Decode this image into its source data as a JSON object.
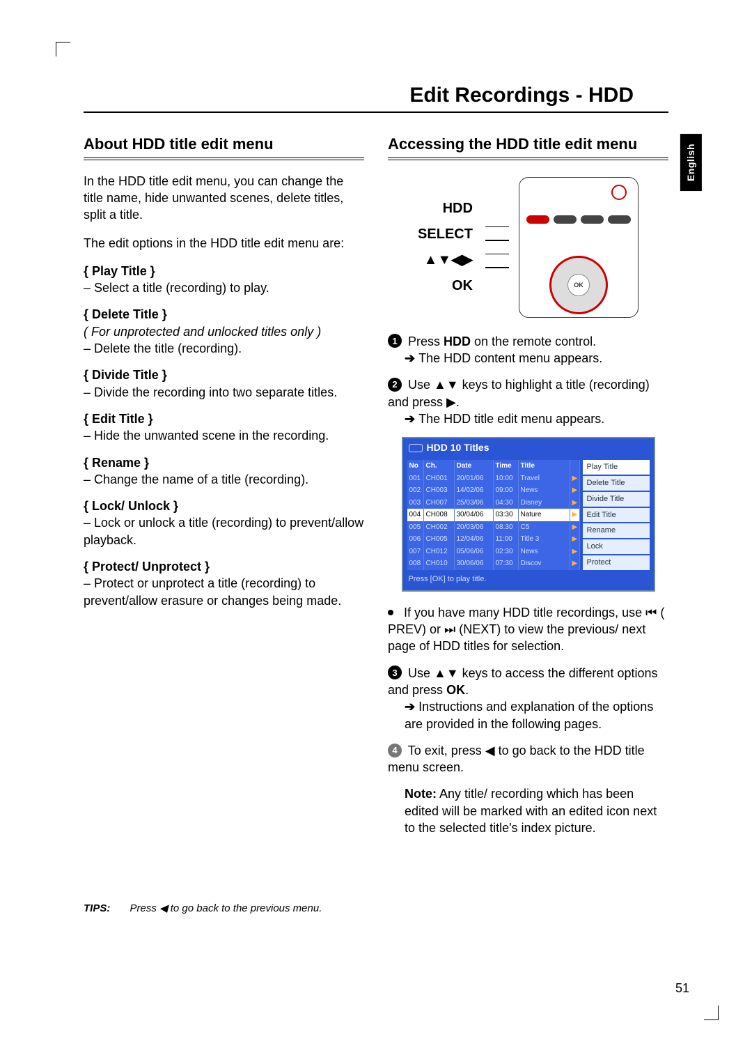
{
  "page_number": "51",
  "language_tab": "English",
  "main_title": "Edit Recordings - HDD",
  "left": {
    "heading": "About HDD title edit menu",
    "intro": "In the HDD title edit menu, you can change the title name, hide unwanted scenes, delete titles, split a title.",
    "intro2": "The edit options in the HDD title edit menu are:",
    "options": [
      {
        "name": "Play Title",
        "note": "",
        "desc": "Select a title (recording) to play."
      },
      {
        "name": "Delete Title",
        "note": "( For unprotected and unlocked titles only )",
        "desc": "Delete the title (recording)."
      },
      {
        "name": "Divide Title",
        "note": "",
        "desc": "Divide the recording into two separate titles."
      },
      {
        "name": "Edit Title",
        "note": "",
        "desc": "Hide the unwanted scene in the recording."
      },
      {
        "name": "Rename",
        "note": "",
        "desc": "Change the name of a title (recording)."
      },
      {
        "name": "Lock/ Unlock",
        "note": "",
        "desc": "Lock or unlock a title (recording) to prevent/allow playback."
      },
      {
        "name": "Protect/ Unprotect",
        "note": "",
        "desc": "Protect or unprotect a title (recording) to prevent/allow erasure or changes being made."
      }
    ]
  },
  "right": {
    "heading": "Accessing the HDD title edit menu",
    "remote_labels": {
      "hdd": "HDD",
      "select": "SELECT",
      "arrows": "▲▼◀▶",
      "ok": "OK"
    },
    "remote_ok": "OK",
    "step1_a": "Press ",
    "step1_bold": "HDD",
    "step1_b": " on the remote control.",
    "step1_result": "The HDD content menu appears.",
    "step2_a": "Use ▲▼ keys to highlight a title (recording) and press ▶.",
    "step2_result": "The HDD title edit menu appears.",
    "bullet_a": "If you have many HDD title recordings, use ⏮ ( PREV) or ⏭ (NEXT) to view the previous/ next page of HDD titles for selection.",
    "step3_a": "Use ▲▼ keys to access the different options and press ",
    "step3_bold": "OK",
    "step3_b": ".",
    "step3_result": "Instructions and explanation of the options are provided in the following pages.",
    "step4": "To exit, press ◀ to go back to the HDD title menu screen.",
    "note_bold": "Note:",
    "note_text": " Any title/ recording which has been edited will be marked with an edited icon next to the selected title's index picture."
  },
  "hdd_fig": {
    "title": "HDD  10 Titles",
    "headers": {
      "no": "No",
      "ch": "Ch.",
      "date": "Date",
      "time": "Time",
      "title": "Title"
    },
    "rows": [
      {
        "no": "001",
        "ch": "CH001",
        "date": "20/01/06",
        "time": "10:00",
        "title": "Travel"
      },
      {
        "no": "002",
        "ch": "CH003",
        "date": "14/02/06",
        "time": "09:00",
        "title": "News"
      },
      {
        "no": "003",
        "ch": "CH007",
        "date": "25/03/06",
        "time": "04:30",
        "title": "Disney"
      },
      {
        "no": "004",
        "ch": "CH008",
        "date": "30/04/06",
        "time": "03:30",
        "title": "Nature"
      },
      {
        "no": "005",
        "ch": "CH002",
        "date": "20/03/06",
        "time": "08:30",
        "title": "C5"
      },
      {
        "no": "006",
        "ch": "CH005",
        "date": "12/04/06",
        "time": "11:00",
        "title": "Title 3"
      },
      {
        "no": "007",
        "ch": "CH012",
        "date": "05/06/06",
        "time": "02:30",
        "title": "News"
      },
      {
        "no": "008",
        "ch": "CH010",
        "date": "30/06/06",
        "time": "07:30",
        "title": "Discov"
      }
    ],
    "selected_index": 3,
    "menu": [
      "Play Title",
      "Delete Title",
      "Divide Title",
      "Edit Title",
      "Rename",
      "Lock",
      "Protect"
    ],
    "footer": "Press [OK] to play title."
  },
  "tips": {
    "label": "TIPS:",
    "text": "Press ◀ to go back to the previous menu."
  }
}
